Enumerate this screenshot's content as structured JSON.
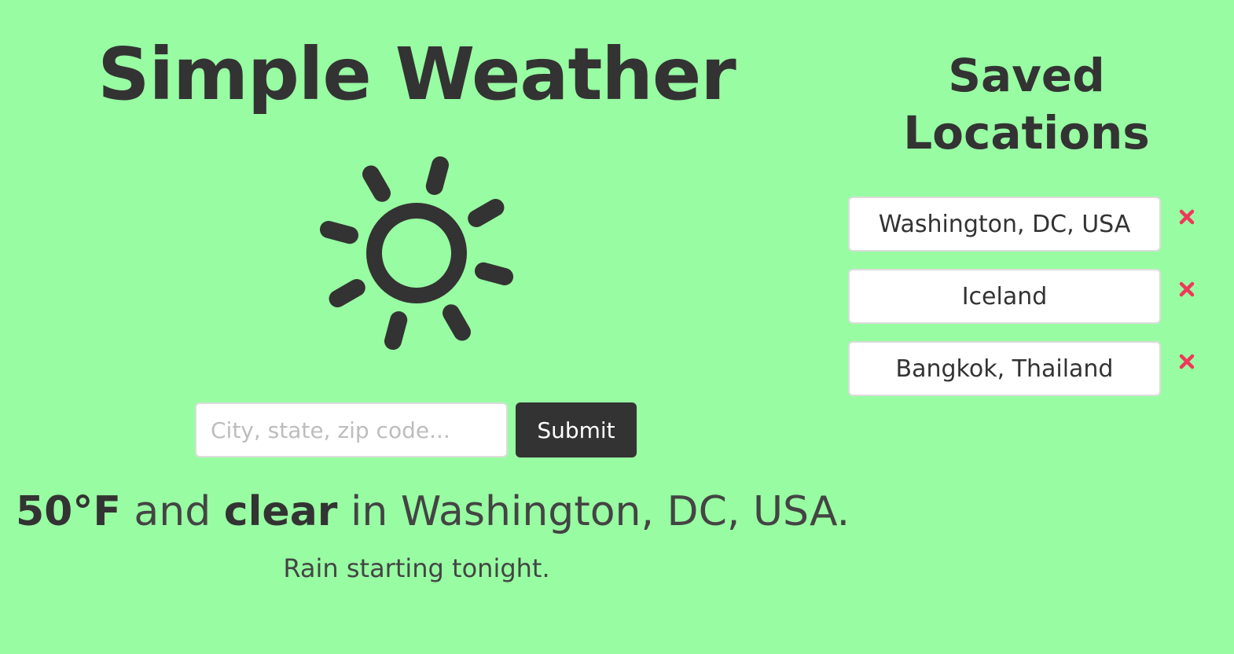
{
  "app": {
    "title": "Simple Weather"
  },
  "current": {
    "icon": "sun-icon",
    "temperature": "50°F",
    "connector": " and ",
    "condition": "clear",
    "location_text": " in Washington, DC, USA.",
    "forecast": "Rain starting tonight."
  },
  "search": {
    "placeholder": "City, state, zip code...",
    "value": "",
    "submit_label": "Submit"
  },
  "saved": {
    "title": "Saved Locations",
    "items": [
      {
        "label": "Washington, DC, USA"
      },
      {
        "label": "Iceland"
      },
      {
        "label": "Bangkok, Thailand"
      }
    ],
    "remove_icon": "close-icon"
  },
  "colors": {
    "background": "#98fda2",
    "text": "#333333",
    "button": "#333333",
    "remove": "#f0385a"
  }
}
